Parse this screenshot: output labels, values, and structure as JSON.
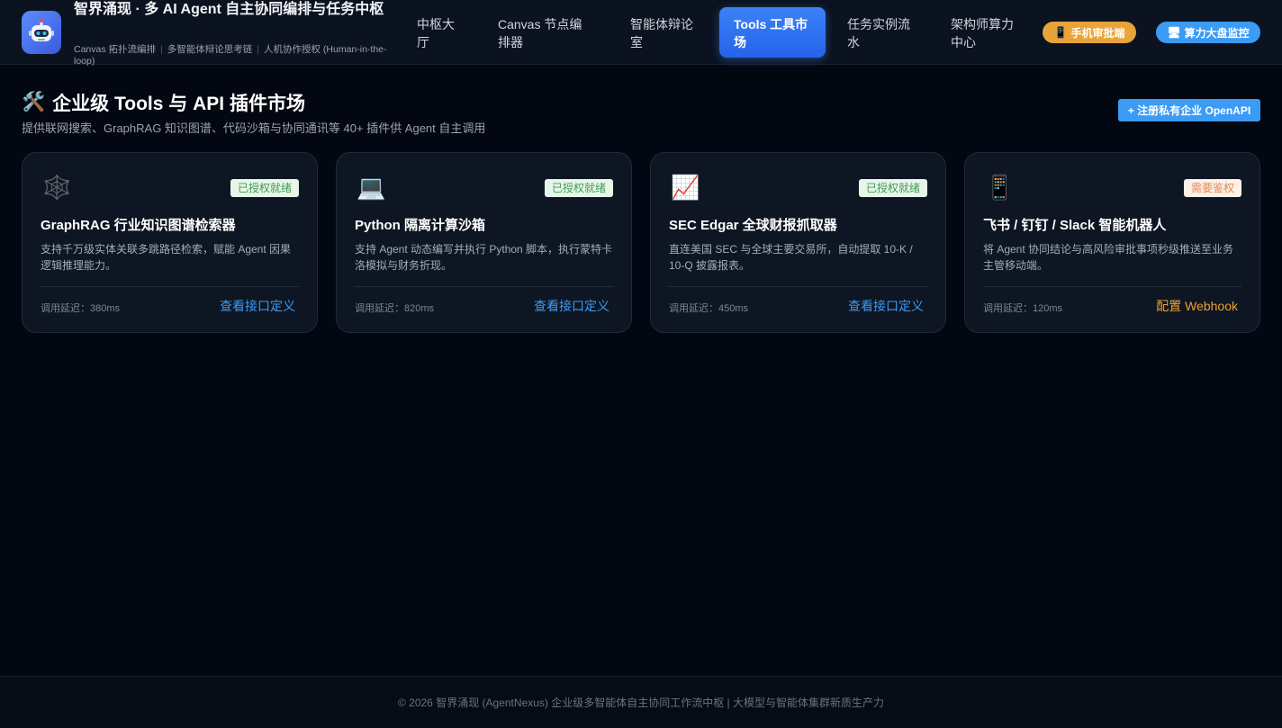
{
  "brand": {
    "title": "智界涌现 · 多 AI Agent 自主协同编排与任务中枢",
    "subtitle_items": [
      "Canvas 拓扑流编排",
      "多智能体辩论思考链",
      "人机协作授权 (Human-in-the-loop)"
    ]
  },
  "nav": {
    "items": [
      {
        "label": "中枢大厅",
        "active": false
      },
      {
        "label": "Canvas 节点编排器",
        "active": false
      },
      {
        "label": "智能体辩论室",
        "active": false
      },
      {
        "label": "Tools 工具市场",
        "active": true
      },
      {
        "label": "任务实例流水",
        "active": false
      },
      {
        "label": "架构师算力中心",
        "active": false
      }
    ]
  },
  "header_buttons": {
    "mobile_review": {
      "icon": "phone-icon",
      "label": "手机审批端"
    },
    "compute_monitor": {
      "icon": "monitor-icon",
      "label": "算力大盘监控"
    }
  },
  "page": {
    "title_icon": "tools-icon",
    "title": "企业级 Tools 与 API 插件市场",
    "subtitle": "提供联网搜索、GraphRAG 知识图谱、代码沙箱与协同通讯等 40+ 插件供 Agent 自主调用",
    "register_button": "+ 注册私有企业 OpenAPI"
  },
  "cards": [
    {
      "icon": "spider-web-icon",
      "badge": "已授权就绪",
      "badge_type": "ok",
      "title": "GraphRAG 行业知识图谱检索器",
      "description": "支持千万级实体关联多跳路径检索，赋能 Agent 因果逻辑推理能力。",
      "latency": "调用延迟：380ms",
      "action": "查看接口定义",
      "action_type": "blue"
    },
    {
      "icon": "laptop-icon",
      "badge": "已授权就绪",
      "badge_type": "ok",
      "title": "Python 隔离计算沙箱",
      "description": "支持 Agent 动态编写并执行 Python 脚本，执行蒙特卡洛模拟与财务折现。",
      "latency": "调用延迟：820ms",
      "action": "查看接口定义",
      "action_type": "blue"
    },
    {
      "icon": "chart-up-icon",
      "badge": "已授权就绪",
      "badge_type": "ok",
      "title": "SEC Edgar 全球财报抓取器",
      "description": "直连美国 SEC 与全球主要交易所，自动提取 10-K / 10-Q 披露报表。",
      "latency": "调用延迟：450ms",
      "action": "查看接口定义",
      "action_type": "blue"
    },
    {
      "icon": "phone-icon",
      "badge": "需要鉴权",
      "badge_type": "warn",
      "title": "飞书 / 钉钉 / Slack 智能机器人",
      "description": "将 Agent 协同结论与高风险审批事项秒级推送至业务主管移动端。",
      "latency": "调用延迟：120ms",
      "action": "配置 Webhook",
      "action_type": "orange"
    }
  ],
  "footer": {
    "text": "© 2026 智界涌现 (AgentNexus) 企业级多智能体自主协同工作流中枢 | 大模型与智能体集群新质生产力"
  }
}
